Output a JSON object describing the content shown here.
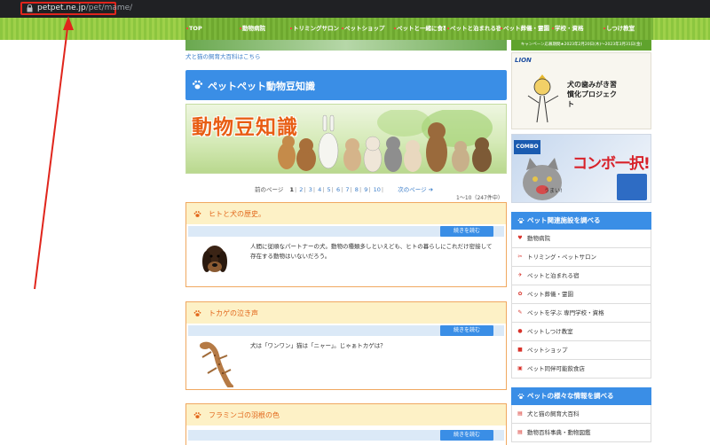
{
  "browser": {
    "url_host": "petpet.ne.jp",
    "url_path": "/pet/mame/"
  },
  "nav": {
    "items": [
      {
        "label": "TOP"
      },
      {
        "label": "動物病院"
      },
      {
        "label": "トリミングサロン"
      },
      {
        "label": "ペットショップ"
      },
      {
        "label": "ペットと一緒に食事"
      },
      {
        "label": "ペットと泊まれる宿"
      },
      {
        "label": "ペット葬儀・霊園"
      },
      {
        "label": "学校・資格"
      },
      {
        "label": "しつけ教室"
      }
    ]
  },
  "campaign_text": "キャンペーン応募期間★2023年2月20日(木)～2023年3月31日(金)",
  "main": {
    "top_link": "犬と猫の飼育大百科はこちら",
    "page_title": "ペットペット動物豆知識",
    "banner_title": "動物豆知識",
    "pager": {
      "prev": "前のページ",
      "pages": [
        "1",
        "2",
        "3",
        "4",
        "5",
        "6",
        "7",
        "8",
        "9",
        "10"
      ],
      "current": "1",
      "next": "次のページ",
      "count": "1～10（247件中）"
    },
    "articles": [
      {
        "title": "ヒトと犬の歴史。",
        "more": "続きを読む",
        "desc": "人間に従順なパートナーの犬。動物の種類多しといえども、ヒトの暮らしにこれだけ密接して存在する動物はいないだろう。",
        "thumb": "dachshund-photo"
      },
      {
        "title": "トカゲの泣き声",
        "more": "続きを読む",
        "desc": "犬は「ワンワン」猫は「ニャー」。じゃぁトカゲは？",
        "thumb": "gecko-photo"
      },
      {
        "title": "フラミンゴの羽根の色",
        "more": "続きを読む"
      }
    ]
  },
  "sidebar": {
    "ad1": {
      "brand": "LION",
      "text": "犬の歯みがき習慣化プロジェクト"
    },
    "ad2": {
      "brand": "COMBO",
      "text": "コンボ一択!",
      "sub": "うまい!"
    },
    "section1": {
      "title": "ペット関連施設を調べる",
      "items": [
        {
          "label": "動物病院",
          "icon": "heart-icon"
        },
        {
          "label": "トリミング・ペットサロン",
          "icon": "scissors-icon"
        },
        {
          "label": "ペットと泊まれる宿",
          "icon": "plane-icon"
        },
        {
          "label": "ペット葬儀・霊園",
          "icon": "flower-icon"
        },
        {
          "label": "ペットを学ぶ 専門学校・資格",
          "icon": "pencil-icon"
        },
        {
          "label": "ペットしつけ教室",
          "icon": "whistle-icon"
        },
        {
          "label": "ペットショップ",
          "icon": "shop-icon"
        },
        {
          "label": "ペット同伴可能飲食店",
          "icon": "cup-icon"
        }
      ]
    },
    "section2": {
      "title": "ペットの様々な情報を調べる",
      "items": [
        {
          "label": "犬と猫の飼育大百科",
          "icon": "book-icon"
        },
        {
          "label": "動物百科事典・動物図鑑",
          "icon": "book-icon"
        }
      ]
    }
  },
  "colors": {
    "accent_blue": "#3a8ee6",
    "nav_green": "#8cc63f",
    "article_orange": "#e2661a",
    "annotation_red": "#e0251c"
  }
}
